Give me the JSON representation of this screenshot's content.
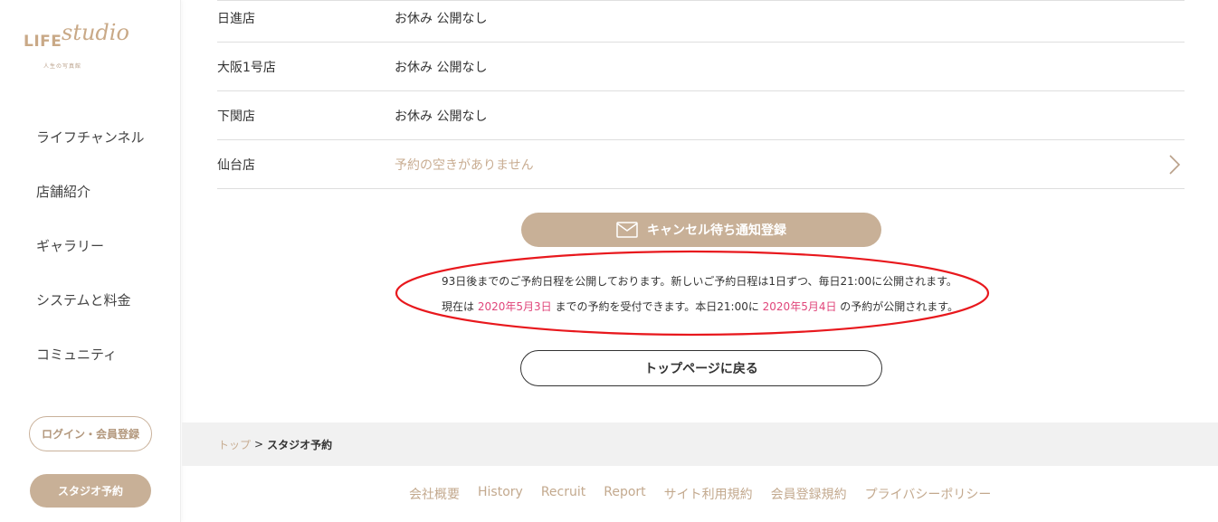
{
  "brand": {
    "logo_main": "LIFE",
    "logo_script": "studio",
    "logo_sub": "人生の写真館",
    "accent_color": "#c8b097",
    "highlight_color": "#e0457a"
  },
  "sidebar": {
    "nav": [
      {
        "label": "ライフチャンネル"
      },
      {
        "label": "店舗紹介"
      },
      {
        "label": "ギャラリー"
      },
      {
        "label": "システムと料金"
      },
      {
        "label": "コミュニティ"
      }
    ],
    "login_label": "ログイン・会員登録",
    "studio_label": "スタジオ予約"
  },
  "stores": [
    {
      "name": "日進店",
      "status": "お休み 公開なし"
    },
    {
      "name": "大阪1号店",
      "status": "お休み 公開なし"
    },
    {
      "name": "下関店",
      "status": "お休み 公開なし"
    },
    {
      "name": "仙台店",
      "status": "予約の空きがありません"
    }
  ],
  "cancel_button": {
    "label": "キャンセル待ち通知登録",
    "icon": "mail-icon"
  },
  "info": {
    "line1": "93日後までのご予約日程を公開しております。新しいご予約日程は1日ずつ、毎日21:00に公開されます。",
    "line2_part1": "現在は ",
    "line2_date1": "2020年5月3日",
    "line2_part2": " までの予約を受付できます。本日21:00に ",
    "line2_date2": "2020年5月4日",
    "line2_part3": " の予約が公開されます。"
  },
  "top_page_button": "トップページに戻る",
  "breadcrumb": {
    "top": "トップ",
    "separator": ">",
    "current": "スタジオ予約"
  },
  "footer": {
    "links": [
      "会社概要",
      "History",
      "Recruit",
      "Report",
      "サイト利用規約",
      "会員登録規約",
      "プライバシーポリシー"
    ]
  }
}
